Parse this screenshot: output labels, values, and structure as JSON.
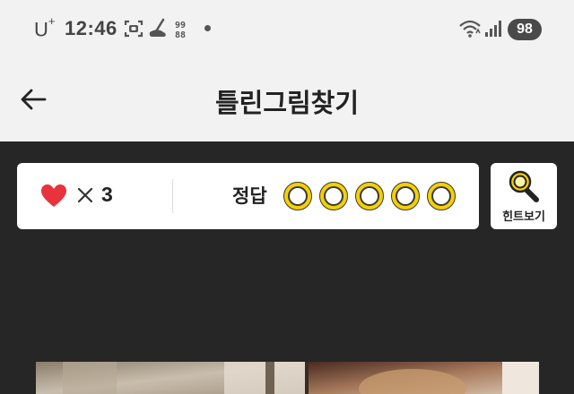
{
  "status_bar": {
    "carrier": "U",
    "carrier_sup": "+",
    "time": "12:46",
    "battery": "98",
    "icons": [
      "screenshot-icon",
      "vacuum-icon",
      "app-badge-icon",
      "notification-dot",
      "wifi-icon",
      "signal-icon"
    ]
  },
  "header": {
    "title": "틀린그림찾기",
    "back_icon": "arrow-left-icon"
  },
  "game": {
    "lives_label": "3",
    "lives_icon": "heart-icon",
    "times_icon": "times-icon",
    "answer_label": "정답",
    "answer_slots": [
      {
        "state": "empty"
      },
      {
        "state": "empty"
      },
      {
        "state": "empty"
      },
      {
        "state": "empty"
      },
      {
        "state": "empty"
      }
    ],
    "hint_label": "힌트보기",
    "hint_icon": "magnifier-icon"
  },
  "colors": {
    "background": "#f2f2f2",
    "game_background": "#262626",
    "heart": "#e8323c",
    "slot_yellow": "#f5d000"
  }
}
